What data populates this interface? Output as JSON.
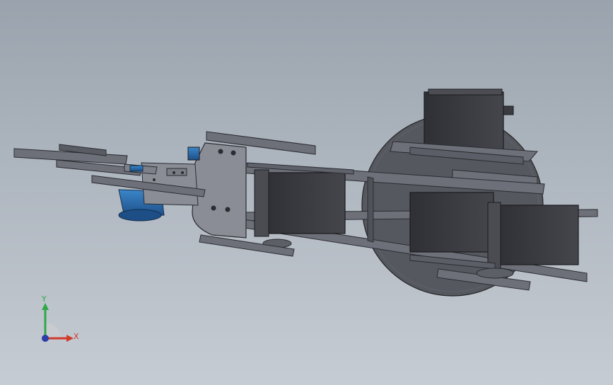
{
  "triad": {
    "x_label": "X",
    "y_label": "Y",
    "x_color": "#d23a2a",
    "y_color": "#2fa84a",
    "z_color": "#2a3fa8"
  },
  "colors": {
    "background_top": "#9aa3ad",
    "background_bottom": "#c6ccd3",
    "plate": "#6d7079",
    "plate_edge": "#2b2c31",
    "servo": "#3d3e43",
    "base_disc": "#55585f",
    "motor_blue": "#2a6fb0"
  }
}
